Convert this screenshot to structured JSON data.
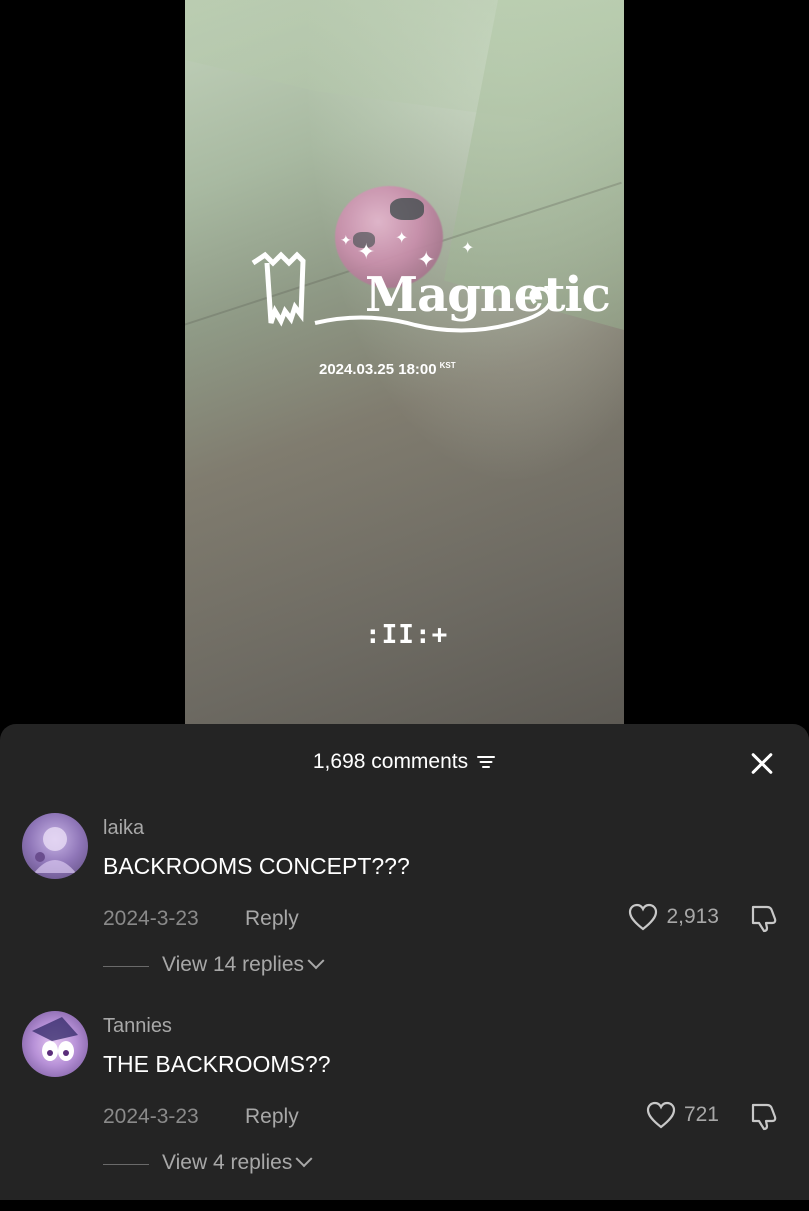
{
  "video": {
    "title_logo": "Magnetic",
    "release_date": "2024.03.25 18:00",
    "release_timezone": "KST",
    "group_logo": ":II:+"
  },
  "comments_panel": {
    "count_label": "1,698 comments",
    "comments": [
      {
        "username": "laika",
        "text": "BACKROOMS CONCEPT???",
        "date": "2024-3-23",
        "reply_label": "Reply",
        "likes": "2,913",
        "view_replies": "View 14 replies"
      },
      {
        "username": "Tannies",
        "text": "THE BACKROOMS??",
        "date": "2024-3-23",
        "reply_label": "Reply",
        "likes": "721",
        "view_replies": "View 4 replies"
      }
    ]
  },
  "icons": [
    "filter-icon",
    "close-icon",
    "heart-icon",
    "dislike-icon",
    "chevron-down-icon"
  ],
  "colors": {
    "panel_bg": "#242424",
    "text_primary": "#ffffff",
    "text_secondary": "#a8a8a8"
  }
}
